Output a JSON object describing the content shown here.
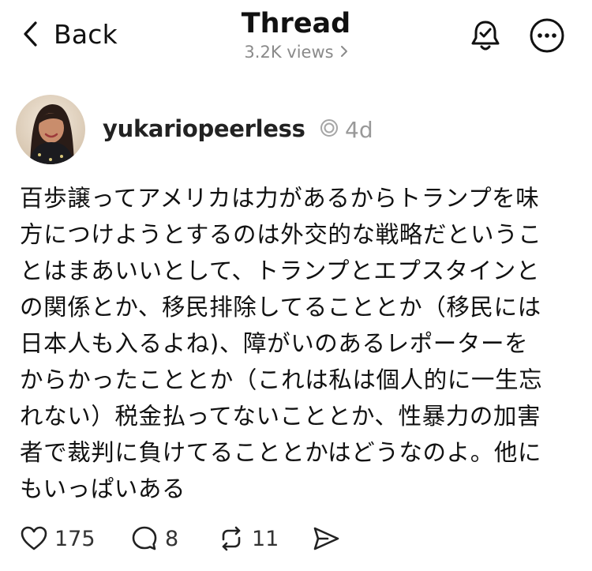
{
  "header": {
    "back_label": "Back",
    "title": "Thread",
    "views": "3.2K views"
  },
  "post": {
    "username": "yukariopeerless",
    "time": "4d",
    "text": "百歩譲ってアメリカは力があるからトランプを味\n方につけようとするのは外交的な戦略だというこ\nとはまあいいとして、トランプとエプスタインと\nの関係とか、移民排除してることとか（移民には\n日本人も入るよね)、障がいのあるレポーターを\nからかったこととか（これは私は個人的に一生忘\nれない）税金払ってないこととか、性暴力の加害\n者で裁判に負けてることとかはどうなのよ。他に\nもいっぱいある",
    "likes": "175",
    "replies": "8",
    "reposts": "11"
  },
  "icons": {
    "back": "chevron-left-icon",
    "views": "chevron-right-icon",
    "bell": "bell-icon",
    "more": "more-icon",
    "status": "status-ring-icon",
    "like": "heart-icon",
    "reply": "comment-icon",
    "repost": "repost-icon",
    "share": "send-icon"
  },
  "colors": {
    "text": "#111111",
    "muted": "#999999",
    "background": "#ffffff"
  }
}
